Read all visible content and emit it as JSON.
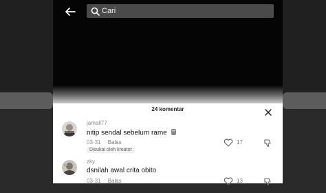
{
  "search": {
    "placeholder": "Cari"
  },
  "comments_panel": {
    "count_label": "24 komentar",
    "comments": [
      {
        "username": "jamall77",
        "text": "nitip sendal sebelum rame",
        "date": "03-31",
        "reply_label": "Balas",
        "creator_liked_label": "Disukai oleh kreator",
        "likes": "17"
      },
      {
        "username": "zky",
        "text": "dsnilah awal crita obito",
        "date": "03-31",
        "reply_label": "Balas",
        "likes": "13"
      }
    ]
  },
  "icons": {
    "back": "back-arrow-icon",
    "search": "search-icon",
    "close": "close-icon",
    "like": "heart-icon",
    "dislike": "thumbs-down-icon"
  }
}
